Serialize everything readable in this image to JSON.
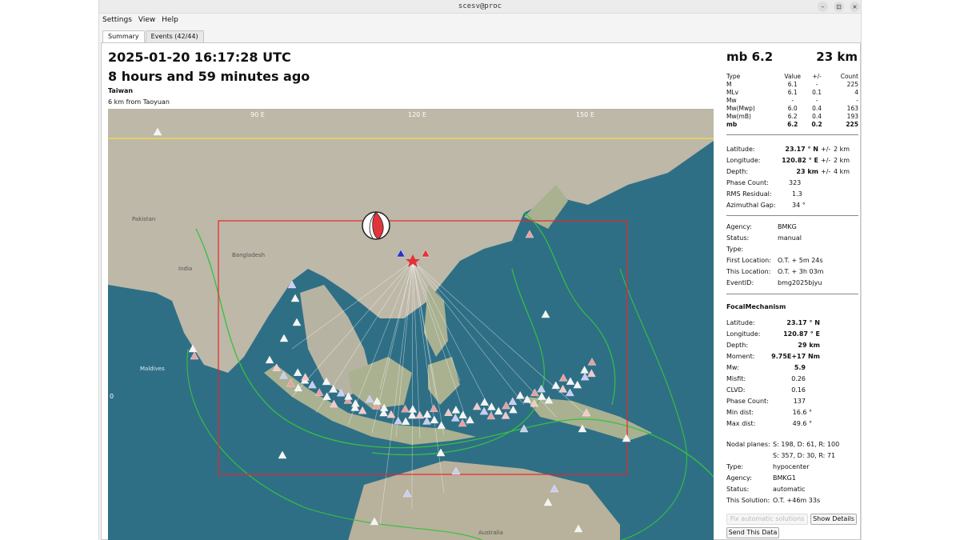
{
  "window": {
    "title": "scesv@proc",
    "btn_min": "–",
    "btn_restore": "⊡",
    "btn_close": "×"
  },
  "menu": {
    "settings": "Settings",
    "view": "View",
    "help": "Help"
  },
  "tabs": {
    "summary": "Summary",
    "events": "Events (42/44)"
  },
  "header": {
    "time": "2025-01-20 16:17:28 UTC",
    "ago": "8 hours and 59 minutes ago",
    "region": "Taiwan",
    "nearby": "6 km from Taoyuan"
  },
  "map": {
    "labels": {
      "lon90": "90 E",
      "lon120": "120 E",
      "lon150": "150 E",
      "lat0": "0",
      "india": "India",
      "australia": "Australia",
      "pakistan": "Pakistan",
      "bangladesh": "Bangladesh",
      "maldives": "Maldives"
    },
    "colors": {
      "ocean": "#2f6f86",
      "land": "#bdb8a8",
      "box": "#e8262a",
      "fault": "#35c13f",
      "ray": "#ffffff"
    }
  },
  "summary": {
    "mag": "mb 6.2",
    "depth": "23 km",
    "mag_table": {
      "header": [
        "Type",
        "Value",
        "+/-",
        "Count"
      ],
      "rows": [
        [
          "M",
          "6.1",
          "-",
          "225"
        ],
        [
          "MLv",
          "6.1",
          "0.1",
          "4"
        ],
        [
          "Mw",
          "-",
          "-",
          "-"
        ],
        [
          "Mw(Mwp)",
          "6.0",
          "0.4",
          "163"
        ],
        [
          "Mw(mB)",
          "6.2",
          "0.4",
          "193"
        ],
        [
          "mb",
          "6.2",
          "0.2",
          "225"
        ]
      ]
    },
    "origin": {
      "lat_k": "Latitude:",
      "lat_v": "23.17 ° N",
      "lat_pm": "+/-",
      "lat_u": "2 km",
      "lon_k": "Longitude:",
      "lon_v": "120.82 ° E",
      "lon_pm": "+/-",
      "lon_u": "2 km",
      "dep_k": "Depth:",
      "dep_v": "23 km",
      "dep_pm": "+/-",
      "dep_u": "4 km",
      "phase_k": "Phase Count:",
      "phase_v": "323",
      "rms_k": "RMS Residual:",
      "rms_v": "1.3",
      "gap_k": "Azimuthal Gap:",
      "gap_v": "34 °"
    },
    "info": {
      "agency_k": "Agency:",
      "agency_v": "BMKG",
      "status_k": "Status:",
      "status_v": "manual",
      "type_k": "Type:",
      "type_v": "",
      "first_k": "First Location:",
      "first_v": "O.T. + 5m 24s",
      "this_k": "This Location:",
      "this_v": "O.T. + 3h 03m",
      "eid_k": "EventID:",
      "eid_v": "bmg2025bjyu"
    },
    "fm": {
      "title": "FocalMechanism",
      "lat_k": "Latitude:",
      "lat_v": "23.17 ° N",
      "lon_k": "Longitude:",
      "lon_v": "120.87 ° E",
      "dep_k": "Depth:",
      "dep_v": "29 km",
      "mom_k": "Moment:",
      "mom_v": "9.75E+17 Nm",
      "mw_k": "Mw:",
      "mw_v": "5.9",
      "mis_k": "Misfit:",
      "mis_v": "0.26",
      "clvd_k": "CLVD:",
      "clvd_v": "0.16",
      "pc_k": "Phase Count:",
      "pc_v": "137",
      "min_k": "Min dist:",
      "min_v": "16.6 °",
      "max_k": "Max dist:",
      "max_v": "49.6 °",
      "np_k": "Nodal planes:",
      "np1": "S: 198, D: 61, R: 100",
      "np2": "S: 357, D: 30, R: 71",
      "type_k": "Type:",
      "type_v": "hypocenter",
      "agency_k": "Agency:",
      "agency_v": "BMKG1",
      "status_k": "Status:",
      "status_v": "automatic",
      "sol_k": "This Solution:",
      "sol_v": "O.T. +46m 33s"
    },
    "buttons": {
      "fix": "Fix automatic solutions",
      "details": "Show Details",
      "send": "Send This Data"
    }
  }
}
